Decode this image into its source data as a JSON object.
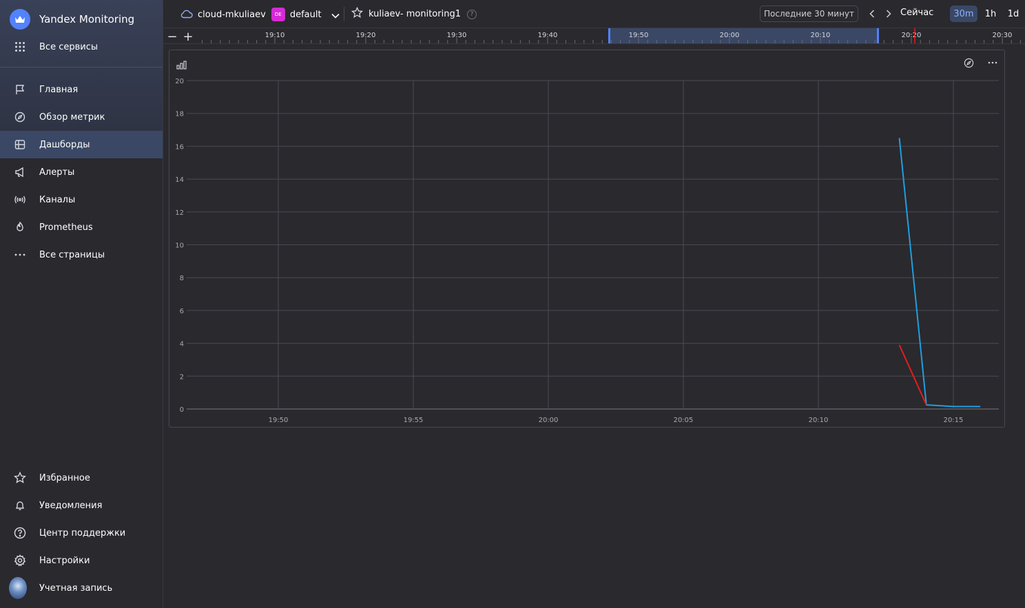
{
  "sidebar": {
    "logo_text": "Yandex Monitoring",
    "all_services": "Все сервисы",
    "items": [
      {
        "label": "Главная",
        "icon": "flag-icon"
      },
      {
        "label": "Обзор метрик",
        "icon": "compass-icon"
      },
      {
        "label": "Дашборды",
        "icon": "dashboard-icon",
        "active": true
      },
      {
        "label": "Алерты",
        "icon": "megaphone-icon"
      },
      {
        "label": "Каналы",
        "icon": "broadcast-icon"
      },
      {
        "label": "Prometheus",
        "icon": "flame-icon"
      },
      {
        "label": "Все страницы",
        "icon": "ellipsis-icon"
      }
    ],
    "bottom": [
      {
        "label": "Избранное",
        "icon": "star-icon"
      },
      {
        "label": "Уведомления",
        "icon": "bell-icon"
      },
      {
        "label": "Центр поддержки",
        "icon": "help-icon"
      },
      {
        "label": "Настройки",
        "icon": "gear-icon"
      },
      {
        "label": "Учетная запись",
        "icon": "avatar"
      }
    ]
  },
  "header": {
    "cloud": "cloud-mkuliaev",
    "folder_badge": "DE",
    "folder": "default",
    "dashboard_title": "kuliaev- monitoring1",
    "help": "?",
    "range_label": "Последние 30 минут",
    "now_label": "Сейчас",
    "zoom_options": [
      "30m",
      "1h",
      "1d"
    ],
    "zoom_selected": "30m"
  },
  "timeline": {
    "zoom_out": "−",
    "zoom_in": "+",
    "ticks": [
      "19:10",
      "19:20",
      "19:30",
      "19:40",
      "19:50",
      "20:00",
      "20:10",
      "20:20",
      "20:30"
    ]
  },
  "chart_data": {
    "type": "line",
    "title": "",
    "xlabel": "",
    "ylabel": "",
    "ylim": [
      0,
      20
    ],
    "y_ticks": [
      0,
      2,
      4,
      6,
      8,
      10,
      12,
      14,
      16,
      18,
      20
    ],
    "x_ticks": [
      "19:50",
      "19:55",
      "20:00",
      "20:05",
      "20:10",
      "20:15"
    ],
    "grid": true,
    "series": [
      {
        "color": "#1f9fe0",
        "points": [
          [
            "20:13",
            16.5
          ],
          [
            "20:14",
            0.25
          ],
          [
            "20:15",
            0.15
          ],
          [
            "20:16",
            0.15
          ]
        ]
      },
      {
        "color": "#e0201f",
        "points": [
          [
            "20:13",
            3.9
          ],
          [
            "20:14",
            0.25
          ]
        ]
      }
    ]
  }
}
